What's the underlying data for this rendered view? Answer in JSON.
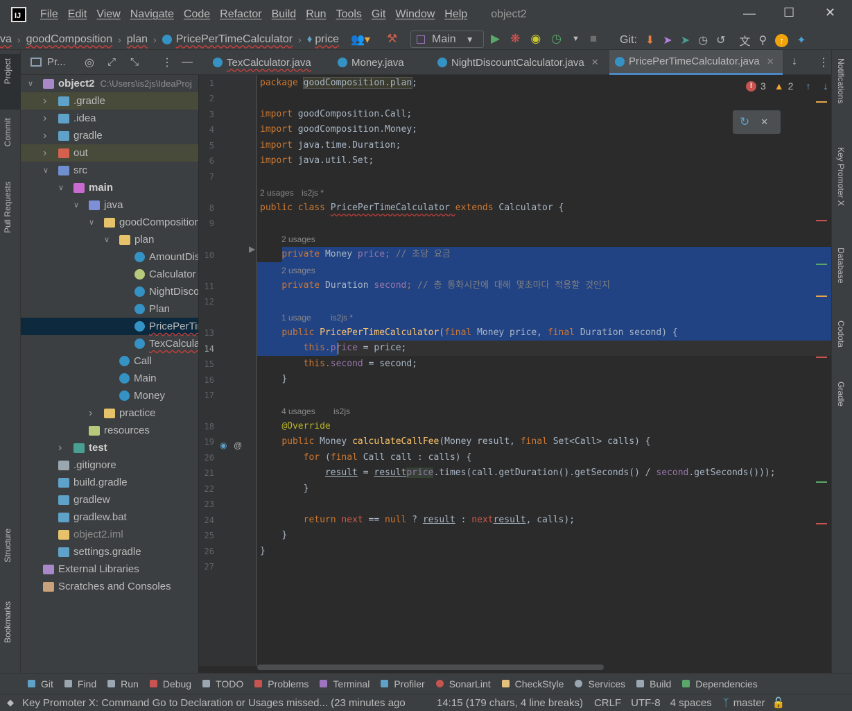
{
  "app": {
    "logo": "IJ",
    "window_title": "object2"
  },
  "menu": [
    "File",
    "Edit",
    "View",
    "Navigate",
    "Code",
    "Refactor",
    "Build",
    "Run",
    "Tools",
    "Git",
    "Window",
    "Help"
  ],
  "breadcrumb": {
    "items": [
      "va",
      "goodComposition",
      "plan",
      "PricePerTimeCalculator",
      "price"
    ]
  },
  "toolbar": {
    "run_config": "Main",
    "git_label": "Git:"
  },
  "left_strip": [
    "Project",
    "Commit",
    "Pull Requests",
    "Structure",
    "Bookmarks"
  ],
  "right_strip": [
    "Notifications",
    "Key Promoter X",
    "Database",
    "Codota",
    "Gradle"
  ],
  "project_panel": {
    "title": "Pr..."
  },
  "tree": [
    {
      "label": "object2",
      "extra": "C:\\Users\\is2js\\IdeaProj",
      "icon": "folder-module",
      "indent": 0,
      "arrow": "down",
      "bold": true
    },
    {
      "label": ".gradle",
      "icon": "folder-gradle",
      "indent": 1,
      "arrow": "right",
      "hl": true
    },
    {
      "label": ".idea",
      "icon": "folder-idea",
      "indent": 1,
      "arrow": "right"
    },
    {
      "label": "gradle",
      "icon": "folder-gradle",
      "indent": 1,
      "arrow": "right"
    },
    {
      "label": "out",
      "icon": "folder-out",
      "indent": 1,
      "arrow": "right",
      "hl": true
    },
    {
      "label": "src",
      "icon": "folder-src",
      "indent": 1,
      "arrow": "down"
    },
    {
      "label": "main",
      "icon": "folder-main",
      "indent": 2,
      "arrow": "down",
      "bold": true
    },
    {
      "label": "java",
      "icon": "folder-java",
      "indent": 3,
      "arrow": "down"
    },
    {
      "label": "goodComposition",
      "icon": "package",
      "indent": 4,
      "arrow": "down"
    },
    {
      "label": "plan",
      "icon": "package",
      "indent": 5,
      "arrow": "down"
    },
    {
      "label": "AmountDiscou",
      "icon": "class",
      "indent": 6
    },
    {
      "label": "Calculator",
      "icon": "abstract",
      "indent": 6
    },
    {
      "label": "NightDiscoun",
      "icon": "class",
      "indent": 6
    },
    {
      "label": "Plan",
      "icon": "class",
      "indent": 6
    },
    {
      "label": "PricePerTime",
      "icon": "class",
      "indent": 6,
      "sel": true
    },
    {
      "label": "TexCalculator",
      "icon": "class",
      "indent": 6
    },
    {
      "label": "Call",
      "icon": "class",
      "indent": 5
    },
    {
      "label": "Main",
      "icon": "class",
      "indent": 5
    },
    {
      "label": "Money",
      "icon": "class",
      "indent": 5
    },
    {
      "label": "practice",
      "icon": "package",
      "indent": 4,
      "arrow": "right"
    },
    {
      "label": "resources",
      "icon": "folder-res",
      "indent": 3
    },
    {
      "label": "test",
      "icon": "folder-test",
      "indent": 2,
      "arrow": "right",
      "bold": true
    },
    {
      "label": ".gitignore",
      "icon": "gitignore",
      "indent": 1
    },
    {
      "label": "build.gradle",
      "icon": "gradle",
      "indent": 1
    },
    {
      "label": "gradlew",
      "icon": "gradle",
      "indent": 1
    },
    {
      "label": "gradlew.bat",
      "icon": "gradle",
      "indent": 1
    },
    {
      "label": "object2.iml",
      "icon": "iml",
      "indent": 1
    },
    {
      "label": "settings.gradle",
      "icon": "gradle",
      "indent": 1
    },
    {
      "label": "External Libraries",
      "icon": "libraries",
      "indent": 0
    },
    {
      "label": "Scratches and Consoles",
      "icon": "scratches",
      "indent": 0
    }
  ],
  "tabs": [
    "TexCalculator.java",
    "Money.java",
    "NightDiscountCalculator.java",
    "PricePerTimeCalculator.java"
  ],
  "inspections": {
    "errors": "3",
    "warnings": "2"
  },
  "line_numbers": [
    "1",
    "2",
    "3",
    "4",
    "5",
    "6",
    "7",
    "8",
    "9",
    "10",
    "11",
    "12",
    "13",
    "14",
    "15",
    "16",
    "17",
    "18",
    "19",
    "20",
    "21",
    "22",
    "23",
    "24",
    "25",
    "26",
    "27"
  ],
  "hints": {
    "h8": "2 usages",
    "h8b": "is2js *",
    "h10": "2 usages",
    "h11": "2 usages",
    "h13": "1 usage",
    "h13b": "is2js *",
    "h18": "4 usages",
    "h18b": "is2js"
  },
  "code": {
    "l1a": "package ",
    "l1b": "goodComposition.plan",
    ";": ";",
    "l3a": "import ",
    "l3b": "goodComposition.Call;",
    "l4b": "goodComposition.Money;",
    "l5b": "java.time.Duration;",
    "l6b": "java.util.Set;",
    "l8a": "public class ",
    "l8b": "PricePerTimeCalculator ",
    "l8c": "extends ",
    "l8d": "Calculator {",
    "l10a": "private ",
    "l10b": "Money ",
    "l10c": "price",
    "l10d": "; ",
    "l10e": "// 초당 요금",
    "l11b": "Duration ",
    "l11c": "second",
    "l11e": "// 총 통화시간에 대해 몇초마다 적용할 것인지",
    "l13a": "public ",
    "l13b": "PricePerTimeCalculator",
    "l13c": "(",
    "l13d": "final ",
    "l13e": "Money price, ",
    "l13g": "Duration second) {",
    "l14a": "this.",
    "l14b": "price",
    " l14c": " = price;",
    "l15b": "second",
    "l15c": " = second;",
    "l16": "}",
    "l18": "@Override",
    "l19a": "public ",
    "l19b": "Money ",
    "l19c": "calculateCallFee",
    "l19d": "(Money result, ",
    "l19e": "final ",
    "l19f": "Set<Call> calls) {",
    "l20a": "for ",
    "l20b": "(",
    "l20c": "final ",
    "l20d": "Call call : calls) {",
    "l21a": "result",
    " l21b": " = ",
    "l21c": "result",
    ".plus(": ".plus(",
    "l21e": "price",
    "l21f": ".times(call.getDuration().getSeconds() / ",
    "l21g": "second",
    "l21h": ".getSeconds()));",
    "l22": "}",
    "l24a": "return ",
    "l24b": "next",
    " l24c": " == ",
    "l24d": "null",
    " l24e": " ? ",
    "l24f": "result",
    " l24g": " : ",
    "l24h": "next",
    ".calc": ".calculateCallFee(",
    "l24j": "result",
    ", calls);": ", calls);",
    "l25": "}",
    "l26": "}"
  },
  "toolwindows": [
    "Git",
    "Find",
    "Run",
    "Debug",
    "TODO",
    "Problems",
    "Terminal",
    "Profiler",
    "SonarLint",
    "CheckStyle",
    "Services",
    "Build",
    "Dependencies"
  ],
  "status": {
    "message": "Key Promoter X: Command Go to Declaration or Usages missed... (23 minutes ago",
    "position": "14:15 (179 chars, 4 line breaks)",
    "line_sep": "CRLF",
    "encoding": "UTF-8",
    "indent": "4 spaces",
    "branch": "master"
  }
}
